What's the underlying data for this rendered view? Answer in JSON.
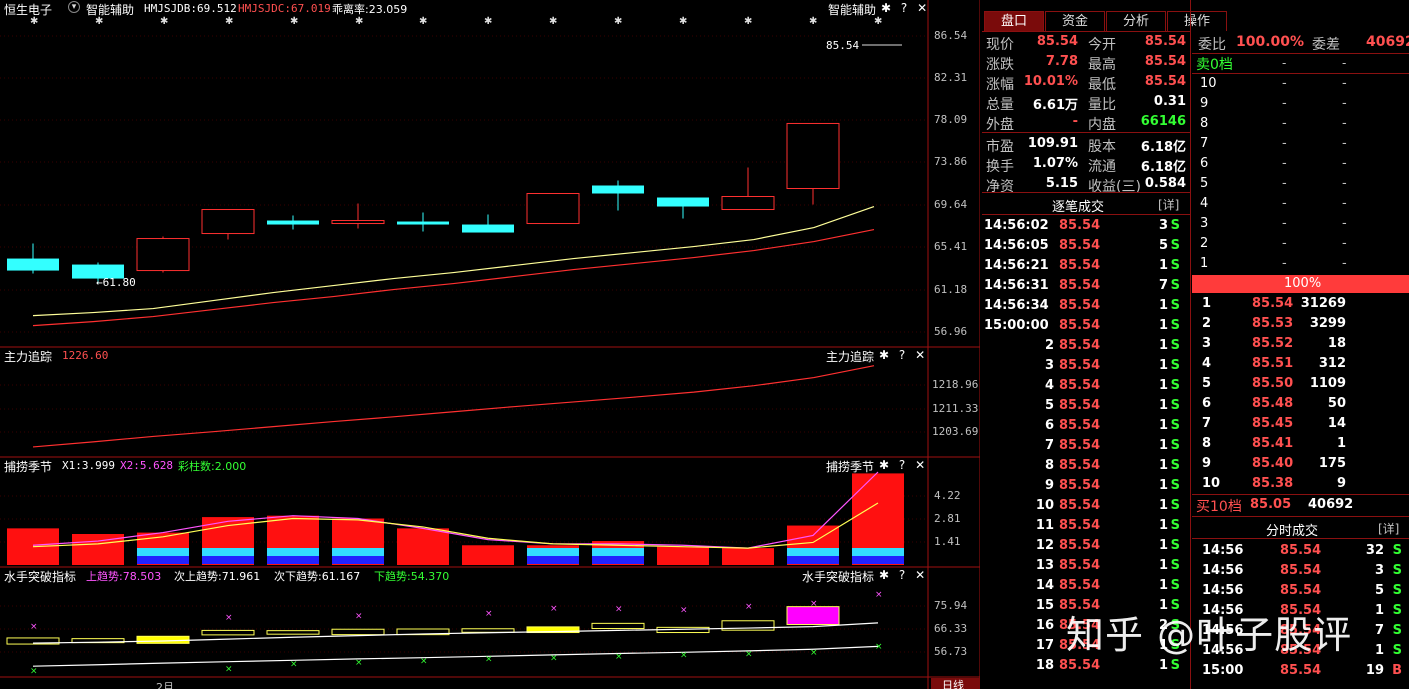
{
  "header": {
    "stock_name": "恒生电子",
    "indicator_name": "智能辅助",
    "hmjsjdb": "HMJSJDB:69.512",
    "hmjsjdc": "HMJSJDC:67.019",
    "deviation": "乖离率:23.059",
    "panel_title": "智能辅助",
    "last_price_tag": "85.54",
    "low_marker": "←61.80"
  },
  "price_axis": [
    "86.54",
    "82.31",
    "78.09",
    "73.86",
    "69.64",
    "65.41",
    "61.18",
    "56.96"
  ],
  "panel2": {
    "name": "主力追踪",
    "value": "1226.60",
    "title": "主力追踪",
    "axis": [
      "1218.96",
      "1211.33",
      "1203.69"
    ]
  },
  "panel3": {
    "name": "捕捞季节",
    "x1": "X1:3.999",
    "x2": "X2:5.628",
    "cnt": "彩柱数:2.000",
    "title": "捕捞季节",
    "axis": [
      "4.22",
      "2.81",
      "1.41"
    ]
  },
  "panel4": {
    "name": "水手突破指标",
    "up": "上趋势:78.503",
    "up2": "次上趋势:71.961",
    "down2": "次下趋势:61.167",
    "down": "下趋势:54.370",
    "title": "水手突破指标",
    "axis": [
      "75.94",
      "66.33",
      "56.73"
    ]
  },
  "bottom": {
    "month": "2月",
    "period": "日线"
  },
  "icons": {
    "gear": "✱",
    "help": "?",
    "close": "✕",
    "dropdown": "▾"
  },
  "tabs": [
    "盘口",
    "资金",
    "分析",
    "操作"
  ],
  "quote": [
    {
      "l1": "现价",
      "v1": "85.54",
      "l2": "今开",
      "v2": "85.54"
    },
    {
      "l1": "涨跌",
      "v1": "7.78",
      "l2": "最高",
      "v2": "85.54"
    },
    {
      "l1": "涨幅",
      "v1": "10.01%",
      "l2": "最低",
      "v2": "85.54"
    },
    {
      "l1": "总量",
      "v1": "6.61万",
      "l2": "量比",
      "v2": "0.31"
    },
    {
      "l1": "外盘",
      "v1": "-",
      "l2": "内盘",
      "v2": "66146"
    },
    {
      "l1": "市盈",
      "v1": "109.91",
      "l2": "股本",
      "v2": "6.18亿"
    },
    {
      "l1": "换手",
      "v1": "1.07%",
      "l2": "流通",
      "v2": "6.18亿"
    },
    {
      "l1": "净资",
      "v1": "5.15",
      "l2": "收益(三)",
      "v2": "0.584"
    }
  ],
  "trade_header": {
    "title": "逐笔成交",
    "detail": "[详]"
  },
  "trades": [
    {
      "t": "14:56:02",
      "p": "85.54",
      "v": "3",
      "s": "S"
    },
    {
      "t": "14:56:05",
      "p": "85.54",
      "v": "5",
      "s": "S"
    },
    {
      "t": "14:56:21",
      "p": "85.54",
      "v": "1",
      "s": "S"
    },
    {
      "t": "14:56:31",
      "p": "85.54",
      "v": "7",
      "s": "S"
    },
    {
      "t": "14:56:34",
      "p": "85.54",
      "v": "1",
      "s": "S"
    },
    {
      "t": "15:00:00",
      "p": "85.54",
      "v": "1",
      "s": "S"
    },
    {
      "t": "2",
      "p": "85.54",
      "v": "1",
      "s": "S"
    },
    {
      "t": "3",
      "p": "85.54",
      "v": "1",
      "s": "S"
    },
    {
      "t": "4",
      "p": "85.54",
      "v": "1",
      "s": "S"
    },
    {
      "t": "5",
      "p": "85.54",
      "v": "1",
      "s": "S"
    },
    {
      "t": "6",
      "p": "85.54",
      "v": "1",
      "s": "S"
    },
    {
      "t": "7",
      "p": "85.54",
      "v": "1",
      "s": "S"
    },
    {
      "t": "8",
      "p": "85.54",
      "v": "1",
      "s": "S"
    },
    {
      "t": "9",
      "p": "85.54",
      "v": "1",
      "s": "S"
    },
    {
      "t": "10",
      "p": "85.54",
      "v": "1",
      "s": "S"
    },
    {
      "t": "11",
      "p": "85.54",
      "v": "1",
      "s": "S"
    },
    {
      "t": "12",
      "p": "85.54",
      "v": "1",
      "s": "S"
    },
    {
      "t": "13",
      "p": "85.54",
      "v": "1",
      "s": "S"
    },
    {
      "t": "14",
      "p": "85.54",
      "v": "1",
      "s": "S"
    },
    {
      "t": "15",
      "p": "85.54",
      "v": "1",
      "s": "S"
    },
    {
      "t": "16",
      "p": "85.54",
      "v": "2",
      "s": "S"
    },
    {
      "t": "17",
      "p": "85.54",
      "v": "1",
      "s": "S"
    },
    {
      "t": "18",
      "p": "85.54",
      "v": "1",
      "s": "S"
    }
  ],
  "orderbook": {
    "ratio_label": "委比",
    "ratio": "100.00%",
    "diff_label": "委差",
    "diff": "40692",
    "sell_head": "卖0档",
    "sell_head_p": "-",
    "sell_head_v": "-",
    "sells": [
      {
        "n": "10",
        "p": "-",
        "v": "-"
      },
      {
        "n": "9",
        "p": "-",
        "v": "-"
      },
      {
        "n": "8",
        "p": "-",
        "v": "-"
      },
      {
        "n": "7",
        "p": "-",
        "v": "-"
      },
      {
        "n": "6",
        "p": "-",
        "v": "-"
      },
      {
        "n": "5",
        "p": "-",
        "v": "-"
      },
      {
        "n": "4",
        "p": "-",
        "v": "-"
      },
      {
        "n": "3",
        "p": "-",
        "v": "-"
      },
      {
        "n": "2",
        "p": "-",
        "v": "-"
      },
      {
        "n": "1",
        "p": "-",
        "v": "-"
      }
    ],
    "bar_label": "100%",
    "buys": [
      {
        "n": "1",
        "p": "85.54",
        "v": "31269"
      },
      {
        "n": "2",
        "p": "85.53",
        "v": "3299"
      },
      {
        "n": "3",
        "p": "85.52",
        "v": "18"
      },
      {
        "n": "4",
        "p": "85.51",
        "v": "312"
      },
      {
        "n": "5",
        "p": "85.50",
        "v": "1109"
      },
      {
        "n": "6",
        "p": "85.48",
        "v": "50"
      },
      {
        "n": "7",
        "p": "85.45",
        "v": "14"
      },
      {
        "n": "8",
        "p": "85.41",
        "v": "1"
      },
      {
        "n": "9",
        "p": "85.40",
        "v": "175"
      },
      {
        "n": "10",
        "p": "85.38",
        "v": "9"
      }
    ],
    "buy_total_label": "买10档",
    "buy_total_p": "85.05",
    "buy_total_v": "40692"
  },
  "minute_header": {
    "title": "分时成交",
    "detail": "[详]"
  },
  "minute_trades": [
    {
      "t": "14:56",
      "p": "85.54",
      "v": "32",
      "s": "S"
    },
    {
      "t": "14:56",
      "p": "85.54",
      "v": "3",
      "s": "S"
    },
    {
      "t": "14:56",
      "p": "85.54",
      "v": "5",
      "s": "S"
    },
    {
      "t": "14:56",
      "p": "85.54",
      "v": "1",
      "s": "S"
    },
    {
      "t": "14:56",
      "p": "85.54",
      "v": "7",
      "s": "S"
    },
    {
      "t": "14:56",
      "p": "85.54",
      "v": "1",
      "s": "S"
    },
    {
      "t": "15:00",
      "p": "85.54",
      "v": "19",
      "s": "B"
    }
  ],
  "watermark": "知乎 @叶子股评",
  "chart_data": {
    "type": "candlestick",
    "title": "恒生电子 日线",
    "ylim": [
      56.96,
      86.54
    ],
    "candles": [
      {
        "o": 64.3,
        "c": 63.1,
        "h": 65.8,
        "l": 62.8,
        "color": "cyan"
      },
      {
        "o": 63.7,
        "c": 62.3,
        "h": 63.9,
        "l": 61.8,
        "color": "cyan"
      },
      {
        "o": 63.1,
        "c": 66.3,
        "h": 66.5,
        "l": 62.9,
        "color": "red"
      },
      {
        "o": 66.8,
        "c": 69.2,
        "h": 69.2,
        "l": 66.2,
        "color": "red"
      },
      {
        "o": 68.1,
        "c": 67.7,
        "h": 68.6,
        "l": 67.2,
        "color": "cyan"
      },
      {
        "o": 67.9,
        "c": 68.1,
        "h": 69.8,
        "l": 67.3,
        "color": "red"
      },
      {
        "o": 68.0,
        "c": 67.9,
        "h": 68.9,
        "l": 67.0,
        "color": "cyan"
      },
      {
        "o": 67.7,
        "c": 66.9,
        "h": 68.7,
        "l": 66.9,
        "color": "cyan"
      },
      {
        "o": 67.8,
        "c": 70.8,
        "h": 70.8,
        "l": 67.8,
        "color": "red"
      },
      {
        "o": 71.6,
        "c": 70.8,
        "h": 72.1,
        "l": 69.1,
        "color": "cyan"
      },
      {
        "o": 70.4,
        "c": 69.5,
        "h": 70.4,
        "l": 68.3,
        "color": "cyan"
      },
      {
        "o": 69.2,
        "c": 70.5,
        "h": 73.4,
        "l": 69.2,
        "color": "red"
      },
      {
        "o": 71.3,
        "c": 77.8,
        "h": 77.8,
        "l": 69.7,
        "color": "red"
      }
    ],
    "ma_yellow": [
      58.6,
      58.9,
      59.3,
      60.1,
      60.9,
      61.6,
      62.3,
      62.9,
      63.6,
      64.3,
      64.9,
      65.5,
      66.2,
      67.4,
      69.5
    ],
    "ma_red": [
      57.6,
      58.0,
      58.5,
      59.2,
      59.9,
      60.5,
      61.2,
      61.8,
      62.5,
      63.2,
      63.8,
      64.4,
      65.1,
      66.0,
      67.2
    ],
    "panel2_line": [
      1201.5,
      1203.0,
      1204.6,
      1206.0,
      1207.5,
      1209.0,
      1210.4,
      1211.9,
      1213.4,
      1214.8,
      1216.2,
      1217.7,
      1219.6,
      1222.0,
      1225.5
    ],
    "panel3_bars": [
      2.6,
      2.2,
      2.3,
      3.4,
      3.5,
      3.3,
      2.6,
      1.4,
      1.4,
      1.7,
      1.3,
      1.2,
      2.8,
      6.5
    ],
    "panel3_cyan": [
      false,
      false,
      true,
      true,
      true,
      true,
      false,
      false,
      true,
      true,
      false,
      false,
      true,
      true
    ],
    "panel3_line_mag": [
      1.4,
      1.7,
      2.3,
      3.1,
      3.5,
      3.3,
      2.6,
      1.8,
      1.5,
      1.5,
      1.4,
      1.2,
      2.1,
      6.6
    ],
    "panel3_line_yel": [
      1.3,
      1.5,
      2.0,
      2.8,
      3.3,
      3.2,
      2.7,
      1.9,
      1.5,
      1.4,
      1.3,
      1.2,
      1.6,
      4.4
    ],
    "panel4_box_top": [
      66.6,
      66.3,
      67.3,
      69.8,
      69.7,
      70.3,
      70.4,
      70.5,
      71.3,
      72.8,
      71.1,
      73.9,
      79.9,
      null
    ],
    "panel4_box_bot": [
      64.0,
      64.6,
      64.3,
      67.9,
      68.2,
      68.0,
      68.0,
      69.0,
      68.9,
      70.6,
      68.9,
      69.9,
      72.3,
      null
    ],
    "panel4_fill": [
      "none",
      "none",
      "yellow",
      "none",
      "none",
      "none",
      "none",
      "none",
      "yellow",
      "none",
      "none",
      "none",
      "magenta",
      null
    ],
    "panel4_white": [
      64.4,
      64.8,
      65.3,
      66.1,
      66.9,
      67.6,
      68.3,
      68.8,
      69.3,
      69.8,
      70.3,
      70.8,
      71.4,
      73.0
    ],
    "panel4_base": [
      54.6,
      55.2,
      55.9,
      56.5,
      57.1,
      57.7,
      58.2,
      58.8,
      59.4,
      60.0,
      60.5,
      61.1,
      61.8,
      63.0
    ],
    "panel4_mag_x": [
      70.4,
      null,
      null,
      74.2,
      null,
      74.8,
      null,
      76.0,
      78.0,
      77.8,
      77.4,
      79.0,
      80.1,
      84.0
    ],
    "panel4_green_x": [
      51.5,
      null,
      null,
      52.4,
      54.5,
      55.0,
      55.8,
      56.6,
      57.1,
      57.6,
      58.2,
      58.7,
      59.4,
      61.8
    ],
    "price_ticks": [
      "86.54",
      "82.31",
      "78.09",
      "73.86",
      "69.64",
      "65.41",
      "61.18",
      "56.96"
    ]
  }
}
